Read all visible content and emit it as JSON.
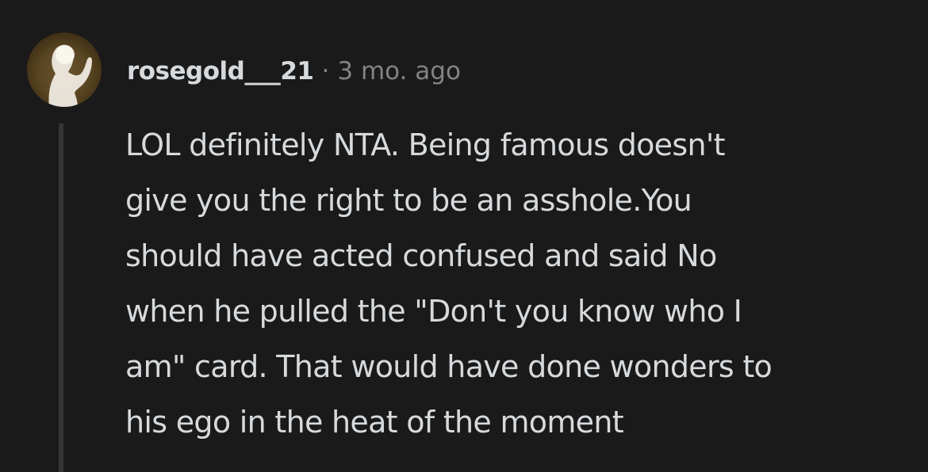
{
  "comment": {
    "author": "rosegold___21",
    "separator": "·",
    "timestamp": "3 mo. ago",
    "avatar_icon": "user-avatar-icon",
    "lines": [
      "LOL definitely NTA. Being famous doesn't",
      "give you the right to be an asshole.You",
      "should have acted confused and said No",
      "when he pulled the \"Don't you know who I",
      "am\" card. That would have done wonders to",
      "his ego in the heat of the moment"
    ]
  },
  "colors": {
    "background": "#1a1a1b",
    "text": "#d7dadc",
    "meta": "#818384",
    "thread_line": "#343536"
  }
}
